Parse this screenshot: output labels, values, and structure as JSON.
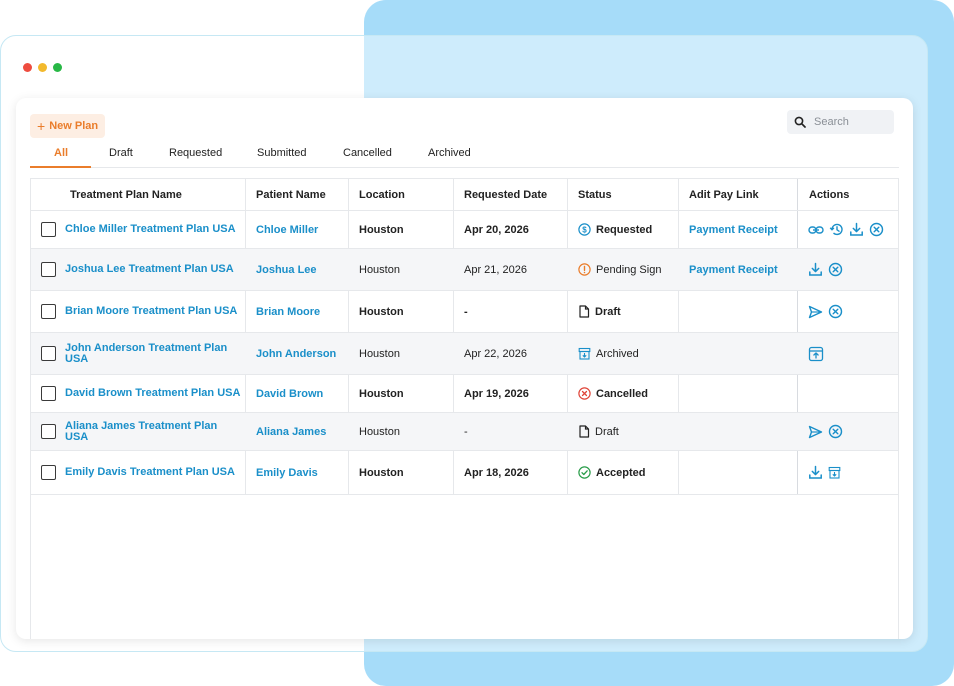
{
  "window": {
    "dots": [
      "#ee4c3f",
      "#f2b92d",
      "#28b846"
    ]
  },
  "toolbar": {
    "new_plan_label": "New Plan"
  },
  "search": {
    "placeholder": "Search"
  },
  "tabs": [
    {
      "label": "All",
      "active": true
    },
    {
      "label": "Draft"
    },
    {
      "label": "Requested"
    },
    {
      "label": "Submitted"
    },
    {
      "label": "Cancelled"
    },
    {
      "label": "Archived"
    }
  ],
  "table": {
    "headers": [
      "Treatment Plan Name",
      "Patient Name",
      "Location",
      "Requested Date",
      "Status",
      "Adit Pay Link",
      "Actions"
    ],
    "rows": [
      {
        "plan": "Chloe Miller Treatment Plan USA",
        "patient": "Chloe Miller",
        "location": "Houston",
        "date": "Apr 20, 2026",
        "status": "Requested",
        "status_icon": "dollar-icon",
        "pay_link": "Payment Receipt",
        "actions": [
          "link-icon",
          "history-icon",
          "download-icon",
          "cancel-icon"
        ]
      },
      {
        "plan": "Joshua Lee Treatment Plan USA",
        "patient": "Joshua Lee",
        "location": "Houston",
        "date": "Apr 21, 2026",
        "status": "Pending Sign",
        "status_icon": "pending-icon",
        "pay_link": "Payment Receipt",
        "actions": [
          "download-icon",
          "cancel-icon"
        ]
      },
      {
        "plan": "Brian Moore Treatment Plan USA",
        "patient": "Brian Moore",
        "location": "Houston",
        "date": "-",
        "status": "Draft",
        "status_icon": "document-icon",
        "pay_link": "",
        "actions": [
          "send-icon",
          "cancel-icon"
        ]
      },
      {
        "plan": "John Anderson Treatment Plan USA",
        "patient": "John Anderson",
        "location": "Houston",
        "date": "Apr 22, 2026",
        "status": "Archived",
        "status_icon": "archive-icon",
        "pay_link": "",
        "actions": [
          "unarchive-icon"
        ]
      },
      {
        "plan": "David Brown Treatment Plan USA",
        "patient": "David Brown",
        "location": "Houston",
        "date": "Apr 19, 2026",
        "status": "Cancelled",
        "status_icon": "cancelled-icon",
        "pay_link": "",
        "actions": []
      },
      {
        "plan": "Aliana James Treatment Plan USA",
        "patient": "Aliana James",
        "location": "Houston",
        "date": "-",
        "status": "Draft",
        "status_icon": "document-icon",
        "pay_link": "",
        "actions": [
          "send-icon",
          "cancel-icon"
        ]
      },
      {
        "plan": "Emily Davis Treatment Plan USA",
        "patient": "Emily Davis",
        "location": "Houston",
        "date": "Apr 18, 2026",
        "status": "Accepted",
        "status_icon": "accepted-icon",
        "pay_link": "",
        "actions": [
          "download-icon",
          "archive-icon"
        ]
      }
    ]
  },
  "colors": {
    "accent": "#ea7d2b",
    "link": "#1a8fc9",
    "backdrop": "#a6dcf9"
  }
}
